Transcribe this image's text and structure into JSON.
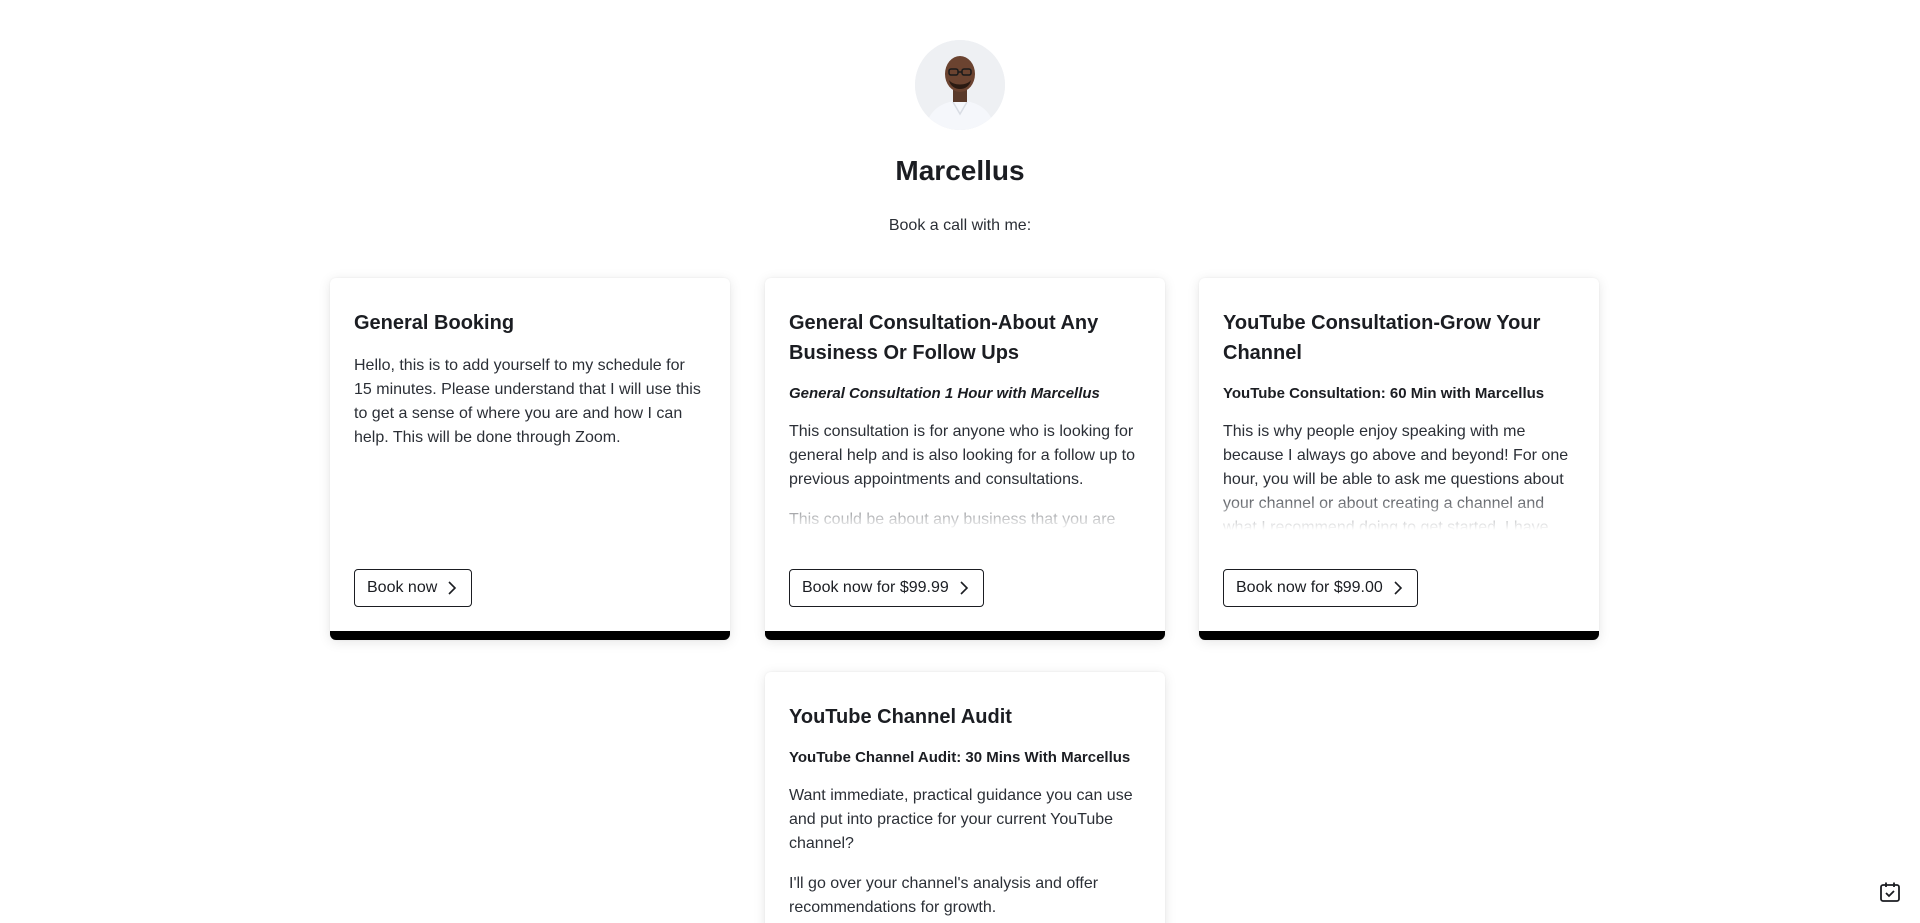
{
  "profile": {
    "name": "Marcellus",
    "tagline": "Book a call with me:"
  },
  "cards": [
    {
      "title": "General Booking",
      "subtitle": "",
      "paragraphs": [
        "Hello, this is to add yourself to my schedule for 15 minutes. Please understand that I will use this to get a sense of where you are and how I can help. This will be done through Zoom."
      ],
      "button": "Book now"
    },
    {
      "title": "General Consultation-About Any Business Or Follow Ups",
      "subtitle": "General Consultation 1 Hour with Marcellus",
      "paragraphs": [
        "This consultation is for anyone who is looking for general help and is also looking for a follow up to previous appointments and consultations.",
        "This could be about any business that you are"
      ],
      "button": "Book now for $99.99"
    },
    {
      "title": "YouTube Consultation-Grow Your Channel",
      "subtitle": "YouTube Consultation: 60 Min with Marcellus",
      "paragraphs": [
        "This is why people enjoy speaking with me because I always go above and beyond! For one hour, you will be able to ask me questions about your channel or about creating a channel and what I recommend doing to get started. I have"
      ],
      "button": "Book now for $99.00"
    },
    {
      "title": "YouTube Channel Audit",
      "subtitle": "YouTube Channel Audit: 30 Mins With Marcellus",
      "paragraphs": [
        "Want immediate, practical guidance you can use and put into practice for your current YouTube channel?",
        "I'll go over your channel's analysis and offer recommendations for growth."
      ],
      "button": ""
    }
  ],
  "icons": {
    "chevron": "chevron-right-icon",
    "calendar": "calendar-check-icon"
  }
}
